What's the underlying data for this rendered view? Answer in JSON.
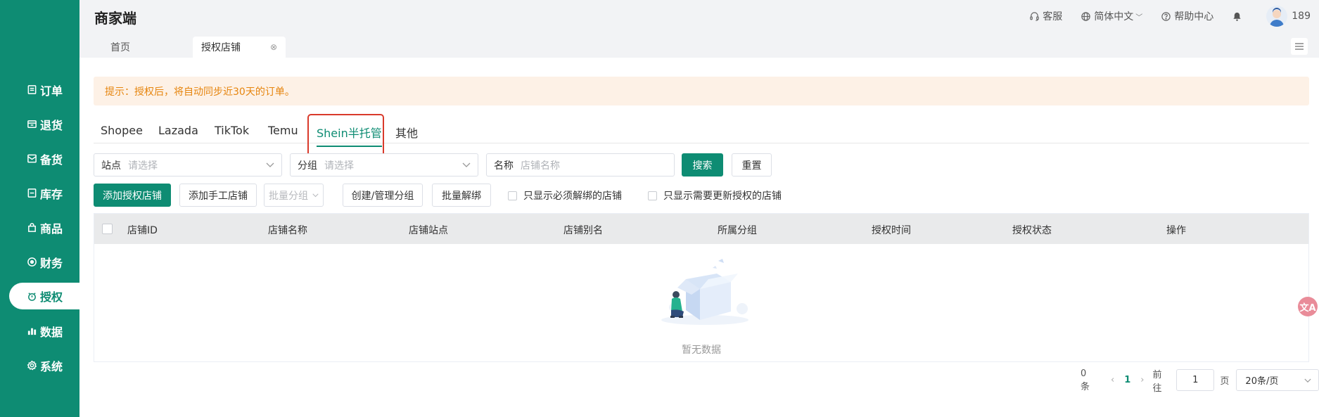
{
  "app": {
    "brand": "商家端"
  },
  "header": {
    "service": "客服",
    "language": "简体中文",
    "help": "帮助中心",
    "user": "189"
  },
  "page_tabs": {
    "home": "首页",
    "active": "授权店铺",
    "close": "⊗"
  },
  "sidebar": {
    "items": [
      {
        "label": "订单",
        "icon": "order-icon"
      },
      {
        "label": "退货",
        "icon": "return-icon"
      },
      {
        "label": "备货",
        "icon": "stock-icon"
      },
      {
        "label": "库存",
        "icon": "inventory-icon"
      },
      {
        "label": "商品",
        "icon": "product-icon"
      },
      {
        "label": "财务",
        "icon": "finance-icon"
      },
      {
        "label": "授权",
        "icon": "authorize-icon"
      },
      {
        "label": "数据",
        "icon": "data-icon"
      },
      {
        "label": "系统",
        "icon": "system-icon"
      }
    ],
    "active": "授权"
  },
  "notice": {
    "text": "提示：授权后，将自动同步近30天的订单。"
  },
  "platform_tabs": {
    "items": [
      "Shopee",
      "Lazada",
      "TikTok",
      "Temu",
      "Shein半托管",
      "其他"
    ],
    "active": "Shein半托管"
  },
  "filters": {
    "site_label": "站点",
    "site_placeholder": "请选择",
    "group_label": "分组",
    "group_placeholder": "请选择",
    "name_label": "名称",
    "name_placeholder": "店铺名称",
    "search": "搜索",
    "reset": "重置"
  },
  "actions": {
    "add_auth": "添加授权店铺",
    "add_manual": "添加手工店铺",
    "batch_group": "批量分组",
    "manage_group": "创建/管理分组",
    "batch_unbind": "批量解绑",
    "only_unbind": "只显示必须解绑的店铺",
    "only_reauth": "只显示需要更新授权的店铺"
  },
  "table": {
    "columns": [
      "店铺ID",
      "店铺名称",
      "店铺站点",
      "店铺别名",
      "所属分组",
      "授权时间",
      "授权状态",
      "操作"
    ],
    "rows": [],
    "empty_text": "暂无数据"
  },
  "pagination": {
    "total": "0条",
    "current_page": "1",
    "goto_label": "前往",
    "goto_value": "1",
    "page_unit": "页",
    "page_size": "20条/页"
  },
  "colors": {
    "brand": "#0e8c73",
    "notice_text": "#e6850e",
    "highlight": "#d93a2b"
  }
}
